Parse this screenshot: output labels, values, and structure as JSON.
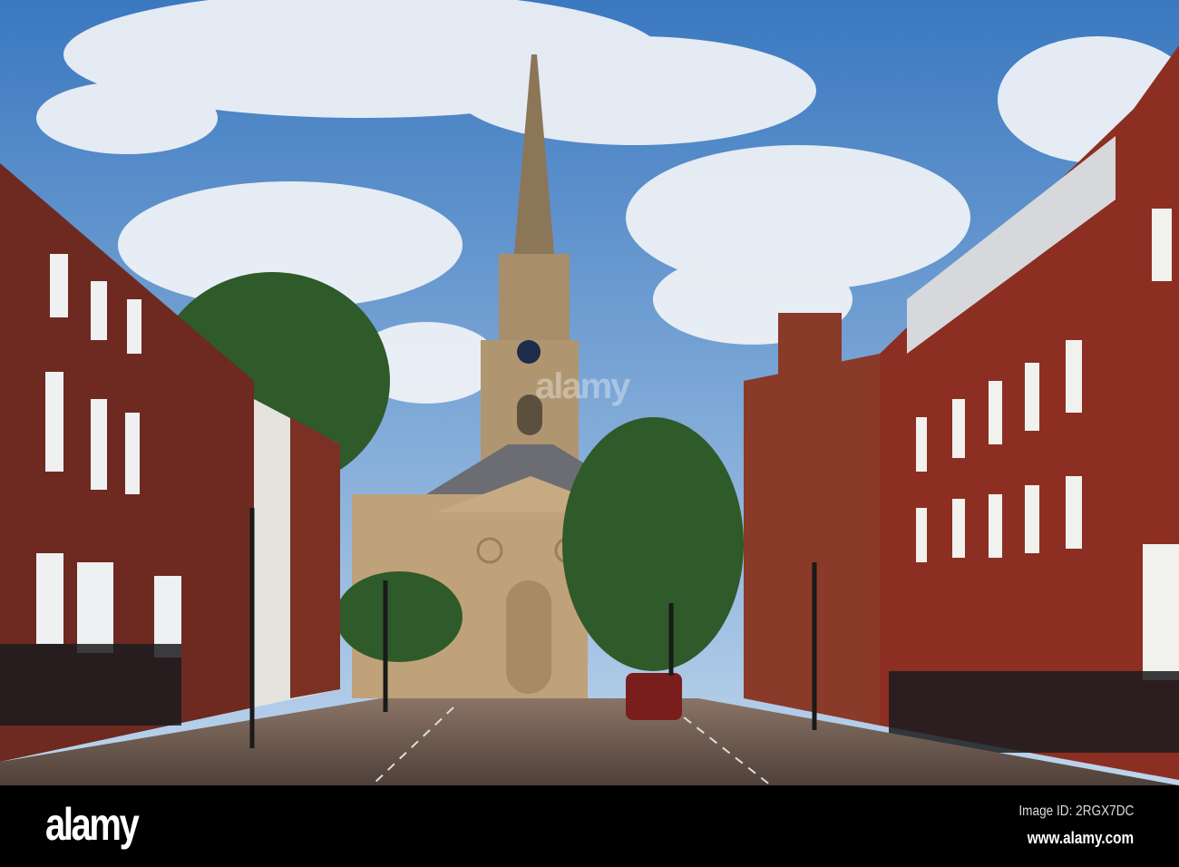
{
  "photo": {
    "subject": "church-spire-street",
    "colors": {
      "sky_top": "#3f7fc4",
      "sky_bottom": "#b9d3ea",
      "brick": "#7a2e22",
      "stone": "#b89a72",
      "tree": "#2f5a2a",
      "road": "#6b5a50"
    }
  },
  "watermark": "alamy",
  "banner": {
    "logo": "alamy",
    "image_id": "Image ID: 2RGX7DC",
    "url": "www.alamy.com"
  }
}
